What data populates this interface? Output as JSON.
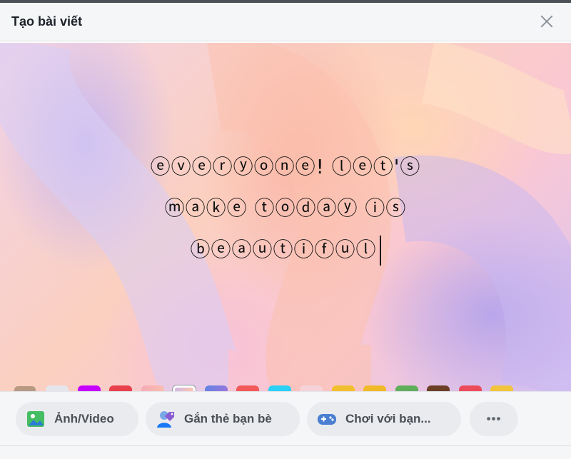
{
  "dialog": {
    "title": "Tạo bài viết"
  },
  "post": {
    "lines": [
      "ⓔⓥⓔⓡⓨⓞⓝⓔ! ⓛⓔⓣ'ⓢ",
      "ⓜⓐⓚⓔ ⓣⓞⓓⓐⓨ ⓘⓢ",
      "ⓑⓔⓐⓤⓣⓘⓕⓤⓛ"
    ]
  },
  "background_swatches": [
    {
      "name": "white",
      "color": "#e4e6eb"
    },
    {
      "name": "purple",
      "color": "#c600ff"
    },
    {
      "name": "red-pattern",
      "color": "#e8414b"
    },
    {
      "name": "pink-gradient",
      "color": "#f6a7b7"
    },
    {
      "name": "pastel-selected",
      "color": "#f4c6d3"
    },
    {
      "name": "blue-purple-gradient",
      "color": "#6a6fd6"
    },
    {
      "name": "coral",
      "color": "#f25a5a"
    },
    {
      "name": "cyan",
      "color": "#2bd0f5"
    },
    {
      "name": "light-pink",
      "color": "#f6d3d8"
    },
    {
      "name": "yellow-face-1",
      "color": "#f2c02e"
    },
    {
      "name": "yellow-face-2",
      "color": "#f0b928"
    },
    {
      "name": "green-pattern",
      "color": "#5fae5b"
    },
    {
      "name": "brown-pattern",
      "color": "#6b3e26"
    },
    {
      "name": "strawberry",
      "color": "#ec4c5a"
    },
    {
      "name": "yellow-face-3",
      "color": "#f1c43c"
    }
  ],
  "actions": {
    "photo_video": "Ảnh/Video",
    "tag_friends": "Gắn thẻ bạn bè",
    "play_with_friends": "Chơi với bạn...",
    "more": "•••"
  },
  "colors": {
    "accent": "#1877f2",
    "photo_green": "#45bd62",
    "tag_blue": "#1877f2",
    "game_blue": "#5b9bd5"
  }
}
